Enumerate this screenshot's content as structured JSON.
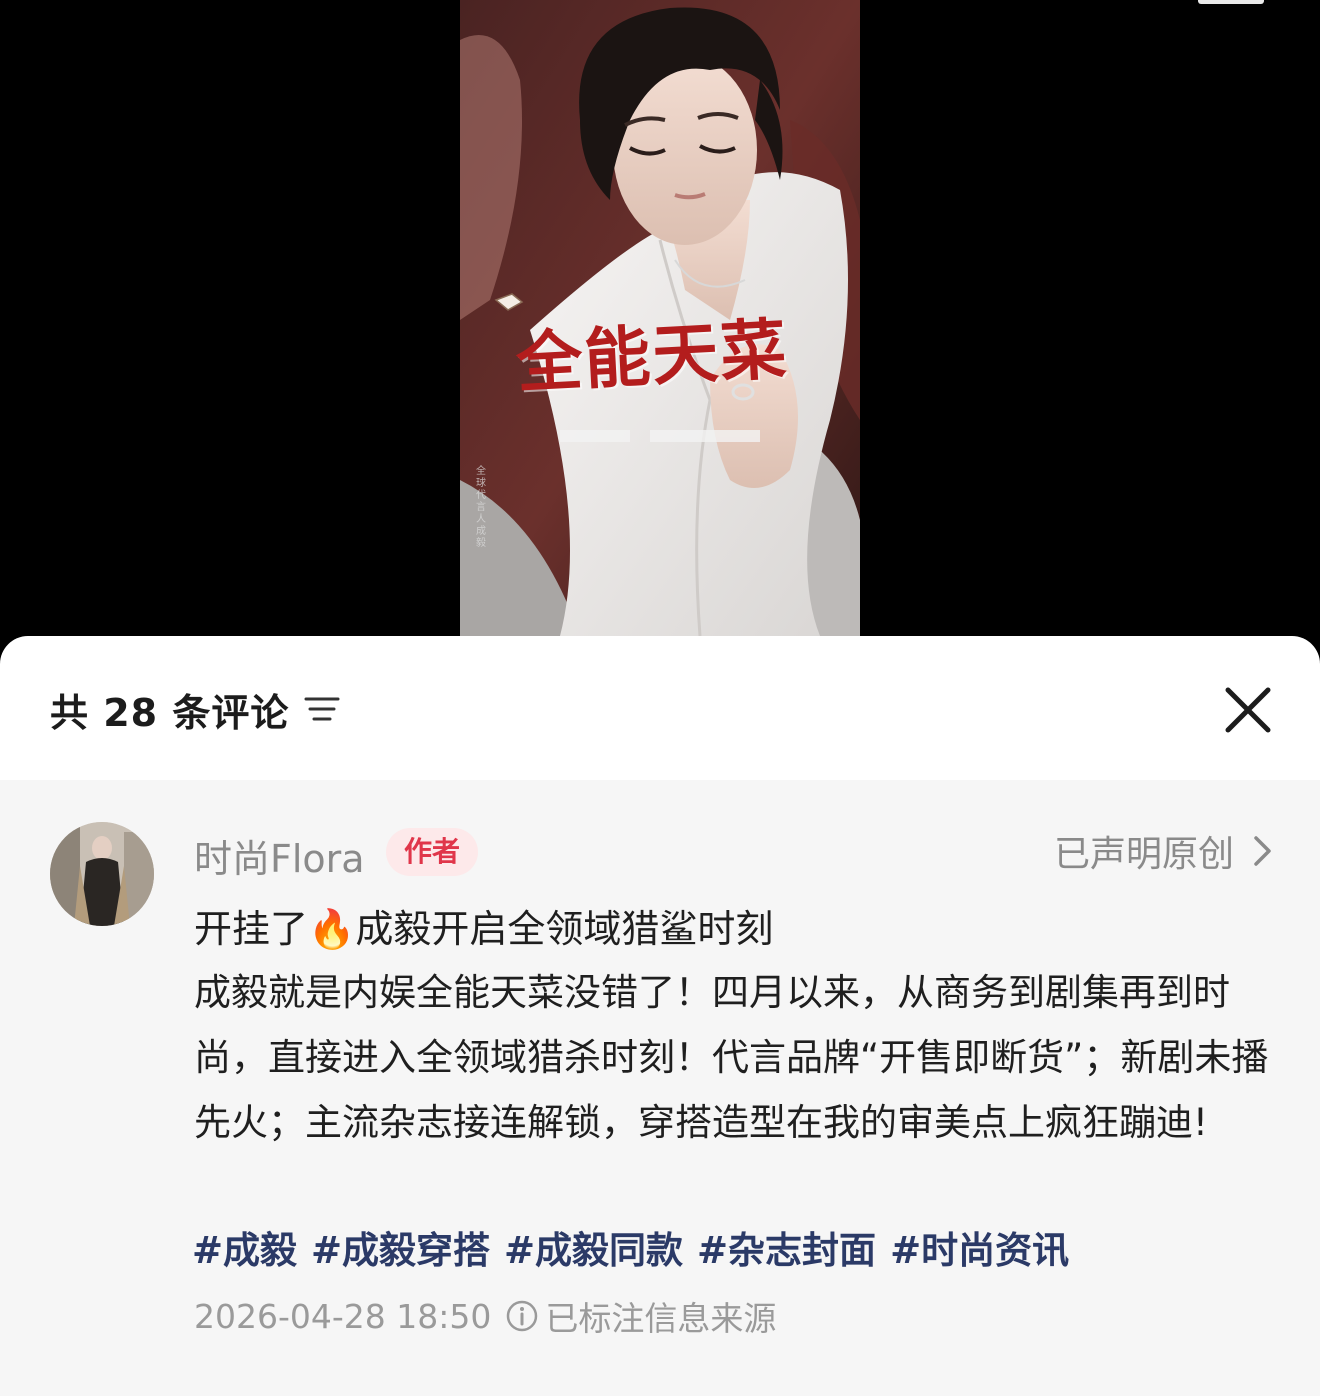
{
  "poster": {
    "title": "全能天菜",
    "vertical_text": "全球代言人 成毅"
  },
  "comments_header": {
    "count_label": "共 28 条评论",
    "sort_icon": "sort-filter-icon",
    "close_icon": "close-icon"
  },
  "comment": {
    "username": "时尚Flora",
    "author_badge": "作者",
    "original_statement": "已声明原创",
    "title": "开挂了🔥成毅开启全领域猎鲨时刻",
    "body": "成毅就是内娱全能天菜没错了！四月以来，从商务到剧集再到时尚，直接进入全领域猎杀时刻！代言品牌“开售即断货”；新剧未播先火；主流杂志接连解锁，穿搭造型在我的审美点上疯狂蹦迪!",
    "hashtags": [
      "#成毅",
      "#成毅穿搭",
      "#成毅同款",
      "#杂志封面",
      "#时尚资讯"
    ],
    "timestamp": "2026-04-28 18:50",
    "source_note": "已标注信息来源"
  },
  "colors": {
    "author_badge_bg": "#fde9ea",
    "author_badge_text": "#e0364a",
    "hashtag": "#2b3a67",
    "poster_title": "#b31d1d"
  }
}
